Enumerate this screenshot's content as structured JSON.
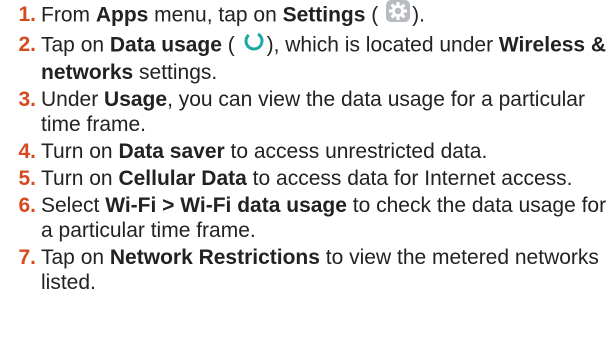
{
  "colors": {
    "number": "#d54a1e",
    "text": "#222222",
    "settings_icon_bg": "#b8bcc0",
    "data_usage_icon": "#1ba8a0"
  },
  "icons": {
    "settings": "gear-icon",
    "data_usage": "data-usage-ring-icon"
  },
  "steps": [
    {
      "num": "1.",
      "t1": "From ",
      "b1": "Apps",
      "t2": " menu, tap on ",
      "b2": "Settings",
      "t3": " (",
      "t4": ")."
    },
    {
      "num": "2.",
      "t1": "Tap on ",
      "b1": "Data usage",
      "t2": " (",
      "t3": "), which is located under ",
      "b2": "Wireless & networks",
      "t4": " settings."
    },
    {
      "num": "3.",
      "t1": "Under ",
      "b1": "Usage",
      "t2": ", you can view the data usage for a particular time frame."
    },
    {
      "num": "4.",
      "t1": "Turn on ",
      "b1": "Data saver",
      "t2": " to access unrestricted data."
    },
    {
      "num": "5.",
      "t1": "Turn on ",
      "b1": "Cellular Data",
      "t2": " to access data for Internet access."
    },
    {
      "num": "6.",
      "t1": "Select ",
      "b1": "Wi-Fi > Wi-Fi data usage",
      "t2": " to check the data usage for a particular time frame."
    },
    {
      "num": "7.",
      "t1": "Tap on ",
      "b1": "Network Restrictions",
      "t2": " to view the metered networks listed."
    }
  ]
}
